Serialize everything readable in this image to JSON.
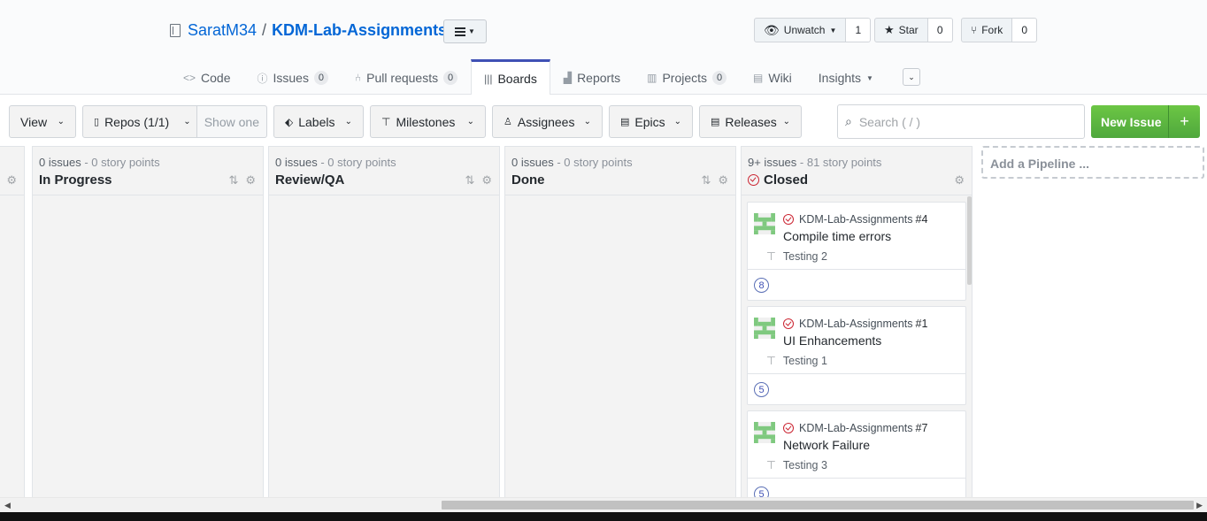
{
  "repo": {
    "owner": "SaratM34",
    "separator": "/",
    "name": "KDM-Lab-Assignments"
  },
  "social": {
    "watch": {
      "label": "Unwatch",
      "count": "1"
    },
    "star": {
      "label": "Star",
      "count": "0"
    },
    "fork": {
      "label": "Fork",
      "count": "0"
    }
  },
  "nav": {
    "tabs": [
      {
        "label": "Code",
        "icon": "code-icon"
      },
      {
        "label": "Issues",
        "badge": "0",
        "icon": "issue-icon"
      },
      {
        "label": "Pull requests",
        "badge": "0",
        "icon": "pull-request-icon"
      },
      {
        "label": "Boards",
        "icon": "boards-icon",
        "active": true
      },
      {
        "label": "Reports",
        "icon": "graph-icon"
      },
      {
        "label": "Projects",
        "badge": "0",
        "icon": "project-icon"
      },
      {
        "label": "Wiki",
        "icon": "book-icon"
      },
      {
        "label": "Insights",
        "icon": "caret-down"
      }
    ]
  },
  "toolbar": {
    "view": "View",
    "repos": "Repos (1/1)",
    "show_one": "Show one",
    "labels": "Labels",
    "milestones": "Milestones",
    "assignees": "Assignees",
    "epics": "Epics",
    "releases": "Releases",
    "search_placeholder": "Search ( / )",
    "new_issue": "New Issue",
    "plus": "+"
  },
  "pipelines": [
    {
      "name": "In Progress",
      "issues": "0 issues",
      "points": "- 0 story points"
    },
    {
      "name": "Review/QA",
      "issues": "0 issues",
      "points": "- 0 story points"
    },
    {
      "name": "Done",
      "issues": "0 issues",
      "points": "- 0 story points"
    },
    {
      "name": "Closed",
      "issues": "9+ issues",
      "points": "- 81 story points"
    }
  ],
  "cards": [
    {
      "repo": "KDM-Lab-Assignments",
      "number": "#4",
      "title": "Compile time errors",
      "milestone": "Testing 2",
      "estimate": "8"
    },
    {
      "repo": "KDM-Lab-Assignments",
      "number": "#1",
      "title": "UI Enhancements",
      "milestone": "Testing 1",
      "estimate": "5"
    },
    {
      "repo": "KDM-Lab-Assignments",
      "number": "#7",
      "title": "Network Failure",
      "milestone": "Testing 3",
      "estimate": "5"
    }
  ],
  "add_pipeline": "Add a Pipeline ...",
  "colors": {
    "accent": "#3f51b5",
    "link": "#0366d6",
    "new_issue_green": "#5cb85c",
    "closed_red": "#cb2431"
  }
}
